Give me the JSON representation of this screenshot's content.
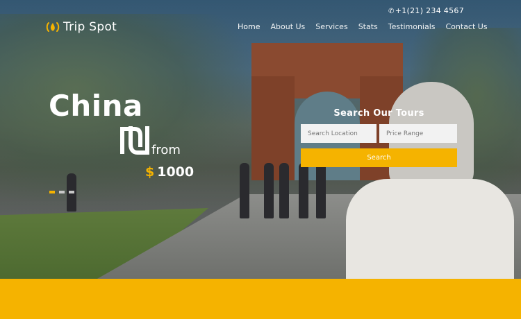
{
  "header": {
    "phone": "+1(21) 234 4567",
    "logo_text": "Trip Spot",
    "nav": [
      "Home",
      "About Us",
      "Services",
      "Stats",
      "Testimonials",
      "Contact Us"
    ]
  },
  "slide": {
    "title": "China",
    "from": "from",
    "price_symbol": "$",
    "price_value": "1000",
    "dots_total": 3,
    "dots_active": 1
  },
  "search": {
    "title": "Search Our Tours",
    "location_placeholder": "Search Location",
    "price_placeholder": "Price Range",
    "button_label": "Search"
  },
  "colors": {
    "accent": "#f5b300",
    "text": "#ffffff"
  }
}
